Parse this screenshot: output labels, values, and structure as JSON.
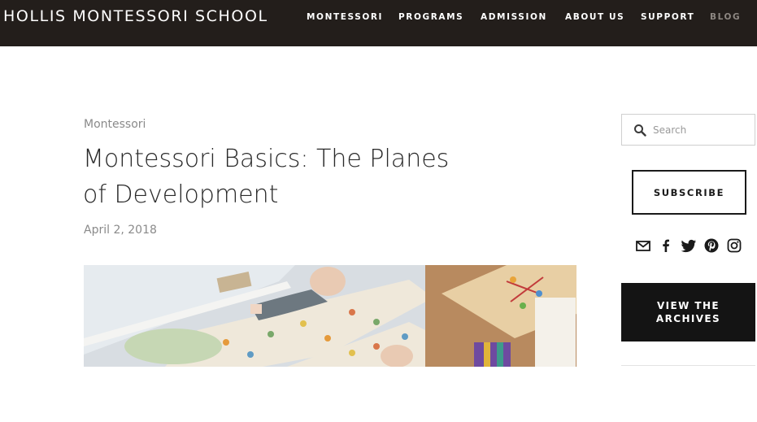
{
  "header": {
    "logo": "HOLLIS MONTESSORI SCHOOL",
    "nav": [
      {
        "label": "MONTESSORI"
      },
      {
        "label": "PROGRAMS"
      },
      {
        "label": "ADMISSION"
      },
      {
        "label": "ABOUT US"
      },
      {
        "label": "SUPPORT"
      },
      {
        "label": "BLOG"
      }
    ],
    "active_color": "#8d8782",
    "background": "#231e1b"
  },
  "post": {
    "category": "Montessori",
    "title": "Montessori Basics: The Planes of Development",
    "date": "April 2, 2018"
  },
  "sidebar": {
    "search_placeholder": "Search",
    "subscribe_label": "SUBSCRIBE",
    "social_icons": [
      "mail-icon",
      "facebook-icon",
      "twitter-icon",
      "pinterest-icon",
      "instagram-icon"
    ],
    "archives_label_line1": "VIEW THE",
    "archives_label_line2": "ARCHIVES"
  }
}
